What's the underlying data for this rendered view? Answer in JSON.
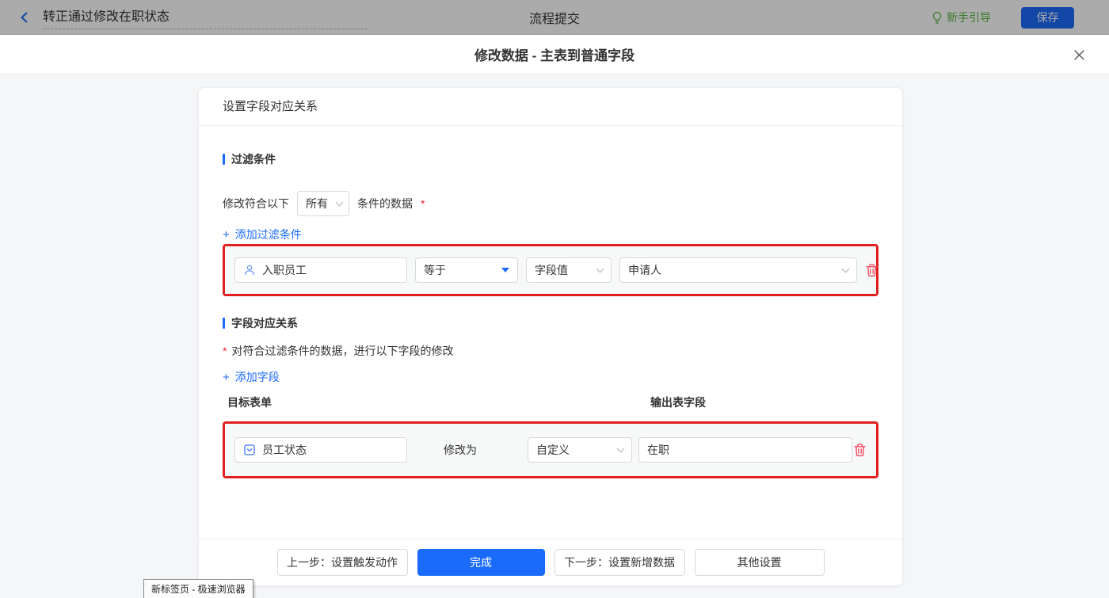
{
  "topbar": {
    "title": "转正通过修改在职状态",
    "center_title": "流程提交",
    "guide_label": "新手引导",
    "save_label": "保存"
  },
  "dialog": {
    "title": "修改数据 - 主表到普通字段"
  },
  "card": {
    "header": "设置字段对应关系"
  },
  "filter": {
    "section_title": "过滤条件",
    "sentence_prefix": "修改符合以下",
    "match_mode": "所有",
    "sentence_suffix": "条件的数据",
    "required_mark": "*",
    "add_plus": "+",
    "add_label": "添加过滤条件",
    "row": {
      "field": "入职员工",
      "operator": "等于",
      "value_type": "字段值",
      "value": "申请人"
    }
  },
  "mapping": {
    "section_title": "字段对应关系",
    "required_mark": "*",
    "description": "对符合过滤条件的数据，进行以下字段的修改",
    "add_plus": "+",
    "add_label": "添加字段",
    "column_left": "目标表单",
    "column_right": "输出表字段",
    "row": {
      "field": "员工状态",
      "action_label": "修改为",
      "value_type": "自定义",
      "value": "在职"
    }
  },
  "footer": {
    "prev_label": "上一步：设置触发动作",
    "done_label": "完成",
    "next_label": "下一步：设置新增数据",
    "other_label": "其他设置"
  },
  "browser_tooltip": "新标签页 - 极速浏览器",
  "colors": {
    "accent": "#1b6bfa",
    "highlight_red": "#e02020",
    "danger": "#f5485d",
    "guide_green": "#57b63c",
    "save_blue": "#1b6bfa"
  }
}
